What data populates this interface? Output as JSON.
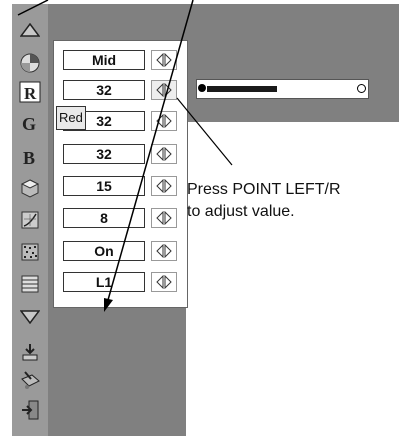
{
  "menu": {
    "tooltip": "Red",
    "rows": [
      {
        "value": "Mid"
      },
      {
        "value": "32"
      },
      {
        "value": "32"
      },
      {
        "value": "32"
      },
      {
        "value": "15"
      },
      {
        "value": "8"
      },
      {
        "value": "On"
      },
      {
        "value": "L1"
      }
    ]
  },
  "slider": {
    "level_fraction": 0.45
  },
  "note": {
    "text": "Press POINT LEFT/R\nto adjust value."
  },
  "icons": [
    "up-arrow-icon",
    "color-wheel-icon",
    "red-letter-icon",
    "green-letter-icon",
    "blue-letter-icon",
    "sharpness-icon",
    "gamma-icon",
    "noise-reduction-icon",
    "progressive-icon",
    "menu-list-icon",
    "down-arrow-icon",
    "store-icon",
    "reset-icon",
    "exit-icon"
  ],
  "colors": {
    "panel": "#808080",
    "sidebar": "#9a9a9a"
  }
}
